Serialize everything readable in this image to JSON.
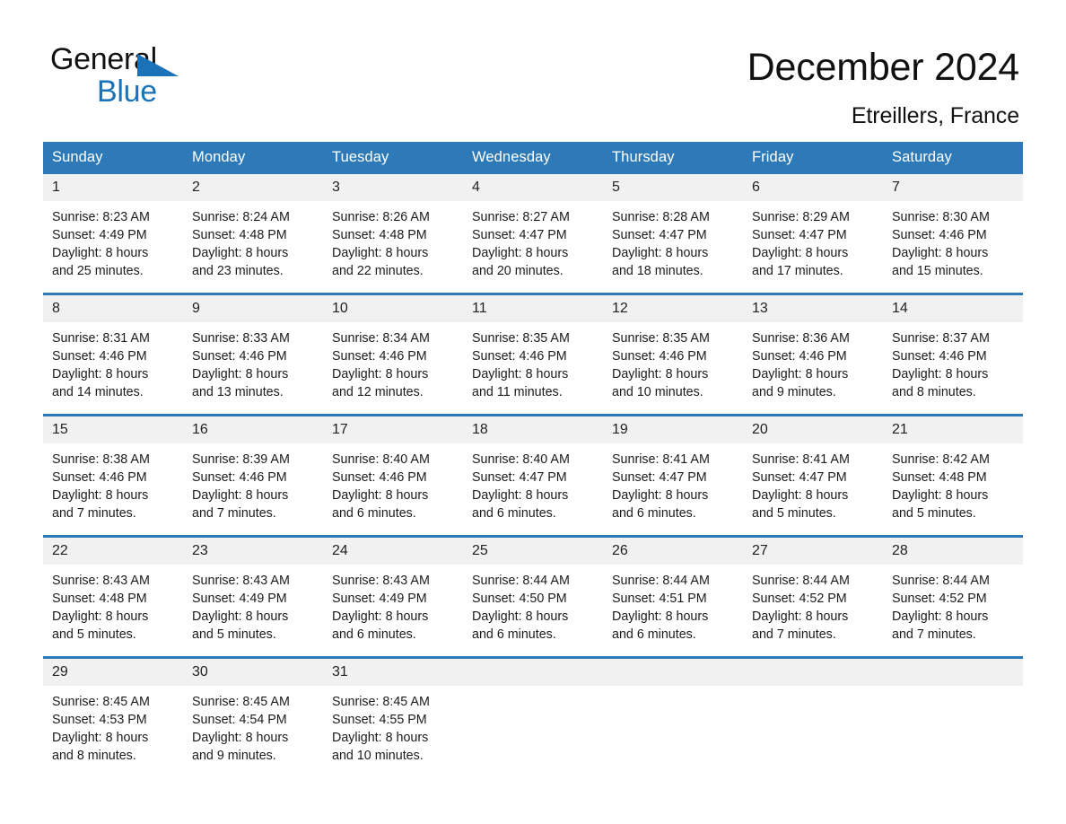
{
  "logo": {
    "word_one": "General",
    "word_two": "Blue",
    "triangle_icon": "triangle-icon"
  },
  "header": {
    "title": "December 2024",
    "location": "Etreillers, France"
  },
  "calendar": {
    "weekday_headers": [
      "Sunday",
      "Monday",
      "Tuesday",
      "Wednesday",
      "Thursday",
      "Friday",
      "Saturday"
    ],
    "accent_color": "#2e7ab8",
    "daynum_band_color": "#f1f1f1",
    "weeks": [
      [
        {
          "day": "1",
          "sunrise": "Sunrise: 8:23 AM",
          "sunset": "Sunset: 4:49 PM",
          "daylight_line1": "Daylight: 8 hours",
          "daylight_line2": "and 25 minutes."
        },
        {
          "day": "2",
          "sunrise": "Sunrise: 8:24 AM",
          "sunset": "Sunset: 4:48 PM",
          "daylight_line1": "Daylight: 8 hours",
          "daylight_line2": "and 23 minutes."
        },
        {
          "day": "3",
          "sunrise": "Sunrise: 8:26 AM",
          "sunset": "Sunset: 4:48 PM",
          "daylight_line1": "Daylight: 8 hours",
          "daylight_line2": "and 22 minutes."
        },
        {
          "day": "4",
          "sunrise": "Sunrise: 8:27 AM",
          "sunset": "Sunset: 4:47 PM",
          "daylight_line1": "Daylight: 8 hours",
          "daylight_line2": "and 20 minutes."
        },
        {
          "day": "5",
          "sunrise": "Sunrise: 8:28 AM",
          "sunset": "Sunset: 4:47 PM",
          "daylight_line1": "Daylight: 8 hours",
          "daylight_line2": "and 18 minutes."
        },
        {
          "day": "6",
          "sunrise": "Sunrise: 8:29 AM",
          "sunset": "Sunset: 4:47 PM",
          "daylight_line1": "Daylight: 8 hours",
          "daylight_line2": "and 17 minutes."
        },
        {
          "day": "7",
          "sunrise": "Sunrise: 8:30 AM",
          "sunset": "Sunset: 4:46 PM",
          "daylight_line1": "Daylight: 8 hours",
          "daylight_line2": "and 15 minutes."
        }
      ],
      [
        {
          "day": "8",
          "sunrise": "Sunrise: 8:31 AM",
          "sunset": "Sunset: 4:46 PM",
          "daylight_line1": "Daylight: 8 hours",
          "daylight_line2": "and 14 minutes."
        },
        {
          "day": "9",
          "sunrise": "Sunrise: 8:33 AM",
          "sunset": "Sunset: 4:46 PM",
          "daylight_line1": "Daylight: 8 hours",
          "daylight_line2": "and 13 minutes."
        },
        {
          "day": "10",
          "sunrise": "Sunrise: 8:34 AM",
          "sunset": "Sunset: 4:46 PM",
          "daylight_line1": "Daylight: 8 hours",
          "daylight_line2": "and 12 minutes."
        },
        {
          "day": "11",
          "sunrise": "Sunrise: 8:35 AM",
          "sunset": "Sunset: 4:46 PM",
          "daylight_line1": "Daylight: 8 hours",
          "daylight_line2": "and 11 minutes."
        },
        {
          "day": "12",
          "sunrise": "Sunrise: 8:35 AM",
          "sunset": "Sunset: 4:46 PM",
          "daylight_line1": "Daylight: 8 hours",
          "daylight_line2": "and 10 minutes."
        },
        {
          "day": "13",
          "sunrise": "Sunrise: 8:36 AM",
          "sunset": "Sunset: 4:46 PM",
          "daylight_line1": "Daylight: 8 hours",
          "daylight_line2": "and 9 minutes."
        },
        {
          "day": "14",
          "sunrise": "Sunrise: 8:37 AM",
          "sunset": "Sunset: 4:46 PM",
          "daylight_line1": "Daylight: 8 hours",
          "daylight_line2": "and 8 minutes."
        }
      ],
      [
        {
          "day": "15",
          "sunrise": "Sunrise: 8:38 AM",
          "sunset": "Sunset: 4:46 PM",
          "daylight_line1": "Daylight: 8 hours",
          "daylight_line2": "and 7 minutes."
        },
        {
          "day": "16",
          "sunrise": "Sunrise: 8:39 AM",
          "sunset": "Sunset: 4:46 PM",
          "daylight_line1": "Daylight: 8 hours",
          "daylight_line2": "and 7 minutes."
        },
        {
          "day": "17",
          "sunrise": "Sunrise: 8:40 AM",
          "sunset": "Sunset: 4:46 PM",
          "daylight_line1": "Daylight: 8 hours",
          "daylight_line2": "and 6 minutes."
        },
        {
          "day": "18",
          "sunrise": "Sunrise: 8:40 AM",
          "sunset": "Sunset: 4:47 PM",
          "daylight_line1": "Daylight: 8 hours",
          "daylight_line2": "and 6 minutes."
        },
        {
          "day": "19",
          "sunrise": "Sunrise: 8:41 AM",
          "sunset": "Sunset: 4:47 PM",
          "daylight_line1": "Daylight: 8 hours",
          "daylight_line2": "and 6 minutes."
        },
        {
          "day": "20",
          "sunrise": "Sunrise: 8:41 AM",
          "sunset": "Sunset: 4:47 PM",
          "daylight_line1": "Daylight: 8 hours",
          "daylight_line2": "and 5 minutes."
        },
        {
          "day": "21",
          "sunrise": "Sunrise: 8:42 AM",
          "sunset": "Sunset: 4:48 PM",
          "daylight_line1": "Daylight: 8 hours",
          "daylight_line2": "and 5 minutes."
        }
      ],
      [
        {
          "day": "22",
          "sunrise": "Sunrise: 8:43 AM",
          "sunset": "Sunset: 4:48 PM",
          "daylight_line1": "Daylight: 8 hours",
          "daylight_line2": "and 5 minutes."
        },
        {
          "day": "23",
          "sunrise": "Sunrise: 8:43 AM",
          "sunset": "Sunset: 4:49 PM",
          "daylight_line1": "Daylight: 8 hours",
          "daylight_line2": "and 5 minutes."
        },
        {
          "day": "24",
          "sunrise": "Sunrise: 8:43 AM",
          "sunset": "Sunset: 4:49 PM",
          "daylight_line1": "Daylight: 8 hours",
          "daylight_line2": "and 6 minutes."
        },
        {
          "day": "25",
          "sunrise": "Sunrise: 8:44 AM",
          "sunset": "Sunset: 4:50 PM",
          "daylight_line1": "Daylight: 8 hours",
          "daylight_line2": "and 6 minutes."
        },
        {
          "day": "26",
          "sunrise": "Sunrise: 8:44 AM",
          "sunset": "Sunset: 4:51 PM",
          "daylight_line1": "Daylight: 8 hours",
          "daylight_line2": "and 6 minutes."
        },
        {
          "day": "27",
          "sunrise": "Sunrise: 8:44 AM",
          "sunset": "Sunset: 4:52 PM",
          "daylight_line1": "Daylight: 8 hours",
          "daylight_line2": "and 7 minutes."
        },
        {
          "day": "28",
          "sunrise": "Sunrise: 8:44 AM",
          "sunset": "Sunset: 4:52 PM",
          "daylight_line1": "Daylight: 8 hours",
          "daylight_line2": "and 7 minutes."
        }
      ],
      [
        {
          "day": "29",
          "sunrise": "Sunrise: 8:45 AM",
          "sunset": "Sunset: 4:53 PM",
          "daylight_line1": "Daylight: 8 hours",
          "daylight_line2": "and 8 minutes."
        },
        {
          "day": "30",
          "sunrise": "Sunrise: 8:45 AM",
          "sunset": "Sunset: 4:54 PM",
          "daylight_line1": "Daylight: 8 hours",
          "daylight_line2": "and 9 minutes."
        },
        {
          "day": "31",
          "sunrise": "Sunrise: 8:45 AM",
          "sunset": "Sunset: 4:55 PM",
          "daylight_line1": "Daylight: 8 hours",
          "daylight_line2": "and 10 minutes."
        },
        {
          "day": "",
          "sunrise": "",
          "sunset": "",
          "daylight_line1": "",
          "daylight_line2": ""
        },
        {
          "day": "",
          "sunrise": "",
          "sunset": "",
          "daylight_line1": "",
          "daylight_line2": ""
        },
        {
          "day": "",
          "sunrise": "",
          "sunset": "",
          "daylight_line1": "",
          "daylight_line2": ""
        },
        {
          "day": "",
          "sunrise": "",
          "sunset": "",
          "daylight_line1": "",
          "daylight_line2": ""
        }
      ]
    ]
  }
}
